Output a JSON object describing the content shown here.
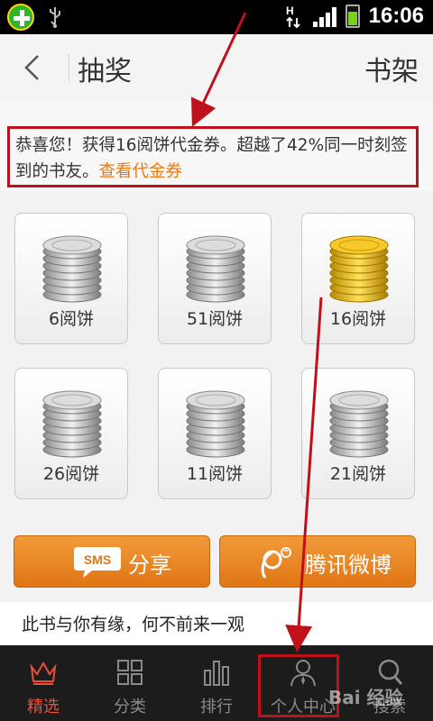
{
  "status_bar": {
    "time": "16:06",
    "icons": [
      "app-badge-icon",
      "usb-icon",
      "hspa-icon",
      "signal-icon",
      "battery-charging-icon"
    ]
  },
  "header": {
    "back_icon": "chevron-left-icon",
    "title": "抽奖",
    "right_action": "书架"
  },
  "message": {
    "text": "恭喜您！获得16阅饼代金券。超越了42%同一时刻签到的书友。",
    "link": "查看代金券"
  },
  "coins": [
    {
      "label": "6阅饼",
      "state": "silver"
    },
    {
      "label": "51阅饼",
      "state": "silver"
    },
    {
      "label": "16阅饼",
      "state": "gold"
    },
    {
      "label": "26阅饼",
      "state": "silver"
    },
    {
      "label": "11阅饼",
      "state": "silver"
    },
    {
      "label": "21阅饼",
      "state": "silver"
    }
  ],
  "share": {
    "sms_icon_text": "SMS",
    "sms_label": "分享",
    "weibo_label": "腾讯微博"
  },
  "tagline": "此书与你有缘，何不前来一观",
  "tabs": [
    {
      "label": "精选",
      "icon": "crown-icon",
      "active": true
    },
    {
      "label": "分类",
      "icon": "grid-icon",
      "active": false
    },
    {
      "label": "排行",
      "icon": "bar-chart-icon",
      "active": false
    },
    {
      "label": "个人中心",
      "icon": "person-icon",
      "active": false
    },
    {
      "label": "搜索",
      "icon": "search-icon",
      "active": false
    }
  ],
  "watermark": "Bai 经验",
  "colors": {
    "accent_orange": "#e87a10",
    "annotation_red": "#c0101a",
    "tab_active": "#e8503a"
  }
}
